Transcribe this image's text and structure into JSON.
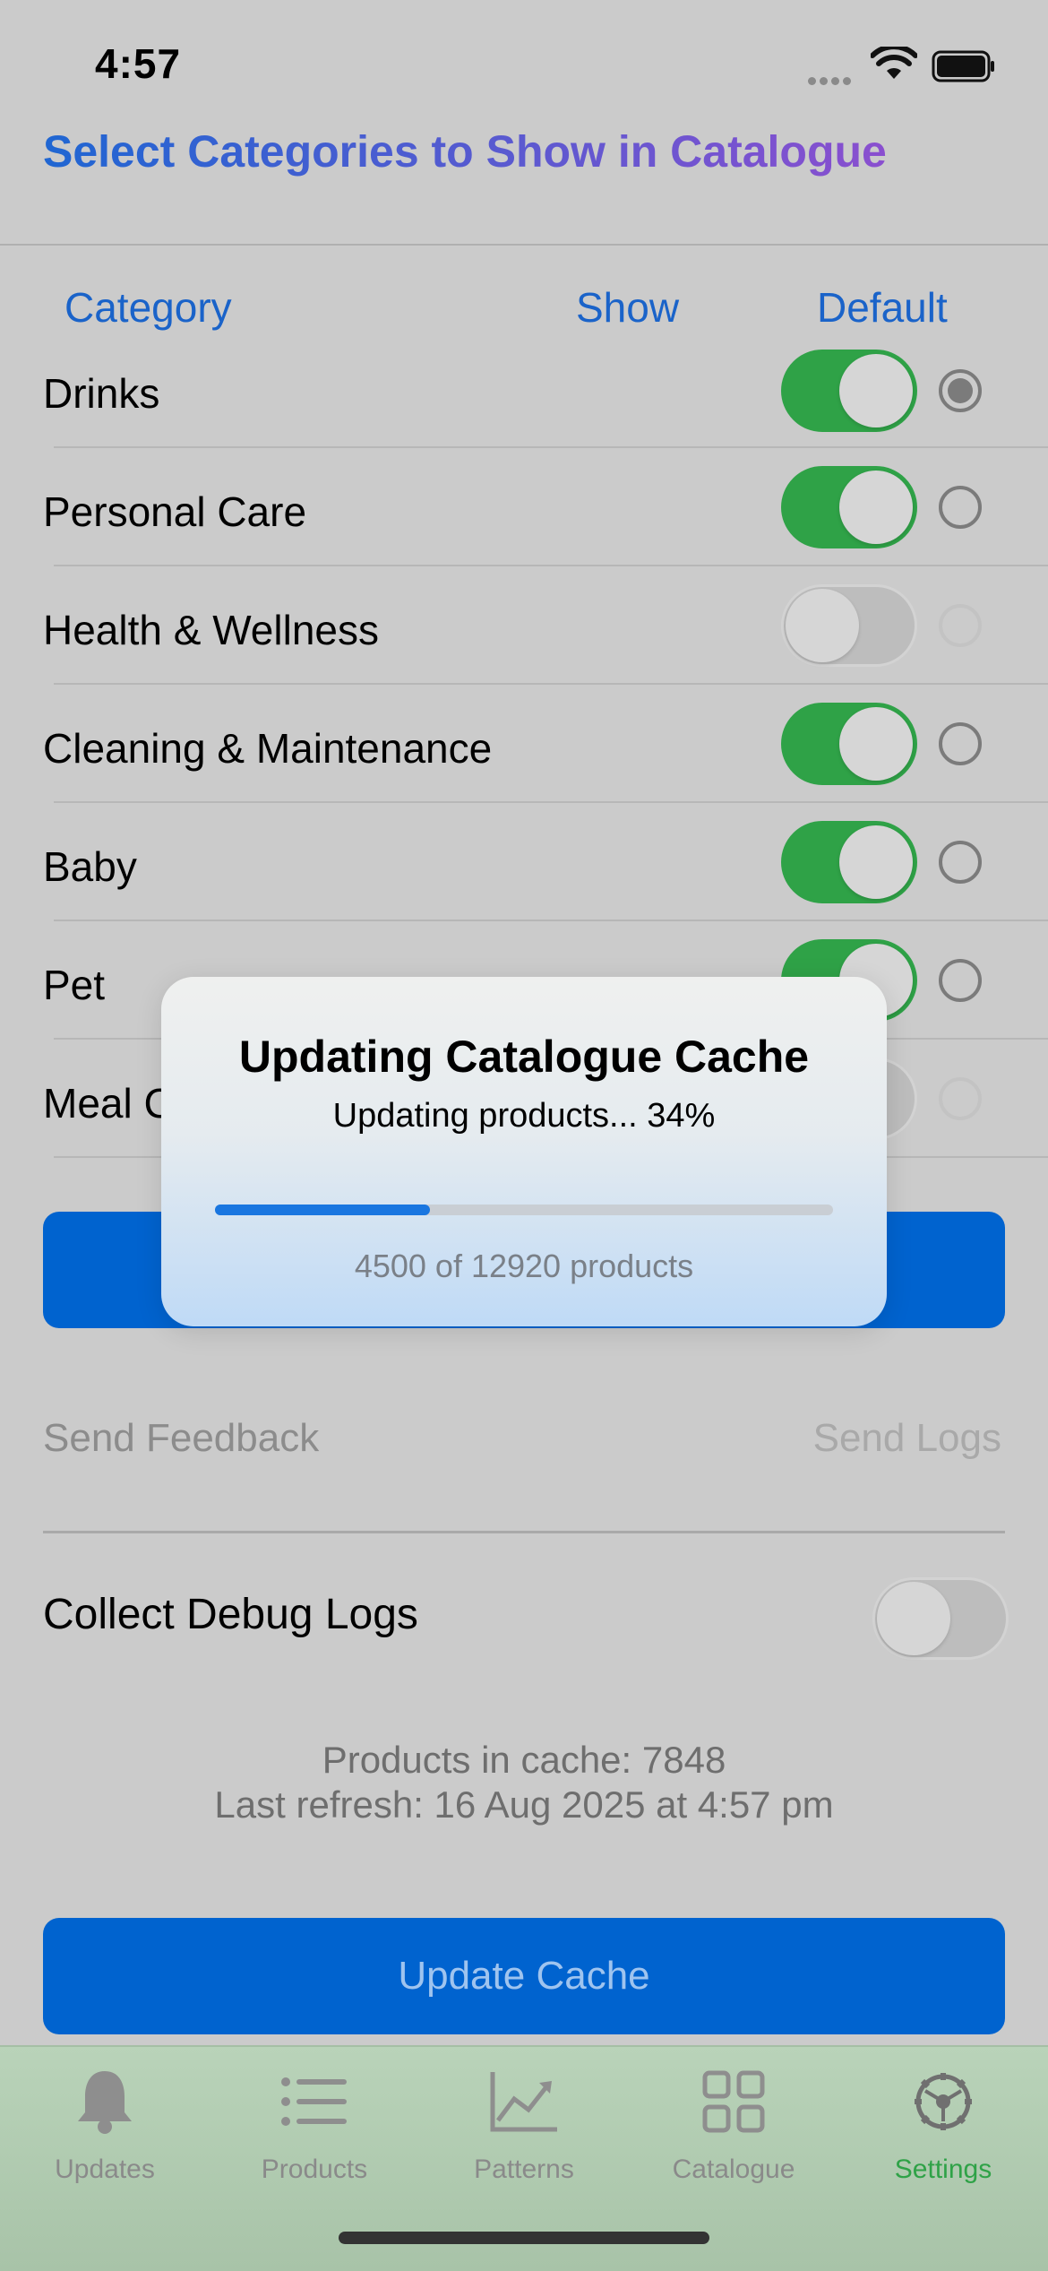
{
  "status_bar": {
    "time": "4:57",
    "icons": [
      "signal-dots-icon",
      "wifi-icon",
      "battery-icon"
    ]
  },
  "section": {
    "title": "Select Categories to Show in Catalogue"
  },
  "columns": {
    "category": "Category",
    "show": "Show",
    "default": "Default"
  },
  "categories": [
    {
      "name": "Drinks",
      "show": true,
      "default": true
    },
    {
      "name": "Personal Care",
      "show": true,
      "default": false
    },
    {
      "name": "Health & Wellness",
      "show": false,
      "default": false
    },
    {
      "name": "Cleaning & Maintenance",
      "show": true,
      "default": false
    },
    {
      "name": "Baby",
      "show": true,
      "default": false
    },
    {
      "name": "Pet",
      "show": true,
      "default": false
    },
    {
      "name": "Meal C",
      "show": false,
      "default": false
    }
  ],
  "feedback": {
    "send_feedback": "Send Feedback",
    "send_logs": "Send Logs"
  },
  "debug": {
    "label": "Collect Debug Logs",
    "enabled": false
  },
  "cache": {
    "products_line": "Products in cache: 7848",
    "refresh_line": "Last refresh: 16 Aug 2025 at 4:57 pm",
    "update_button": "Update Cache"
  },
  "dialog": {
    "title": "Updating Catalogue Cache",
    "message": "Updating products... 34%",
    "progress_fraction": 0.348,
    "count_text": "4500 of 12920 products"
  },
  "tabs": [
    {
      "label": "Updates",
      "icon": "bell-icon",
      "active": false
    },
    {
      "label": "Products",
      "icon": "list-icon",
      "active": false
    },
    {
      "label": "Patterns",
      "icon": "chart-icon",
      "active": false
    },
    {
      "label": "Catalogue",
      "icon": "grid-icon",
      "active": false
    },
    {
      "label": "Settings",
      "icon": "gear-icon",
      "active": true
    }
  ],
  "colors": {
    "accent": "#0063cf",
    "toggle_on": "#2fa247",
    "active_tab": "#2fa247"
  }
}
